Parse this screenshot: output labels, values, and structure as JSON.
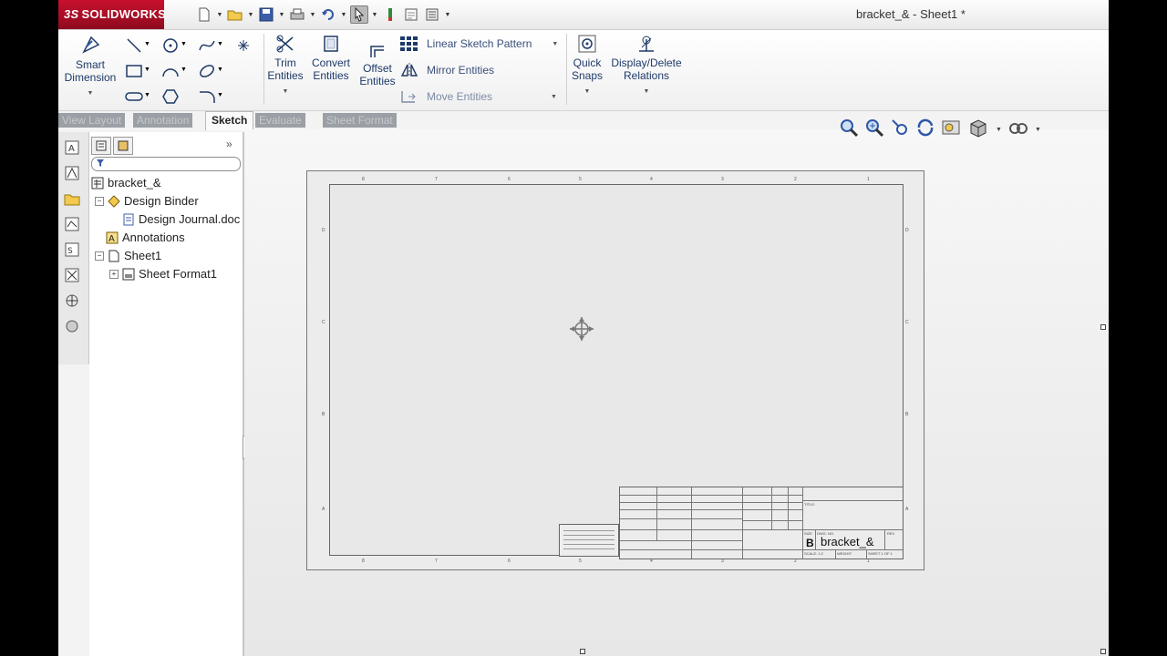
{
  "app": {
    "brand": "SOLIDWORKS",
    "brand_prefix": "3S",
    "document_title": "bracket_& - Sheet1 *",
    "accent_color": "#c8102e"
  },
  "quick_access": {
    "icons": [
      "new-icon",
      "open-icon",
      "save-icon",
      "print-icon",
      "undo-icon",
      "select-icon",
      "rebuild-icon",
      "file-properties-icon",
      "options-icon"
    ]
  },
  "command_manager": {
    "smart_dimension": "Smart\nDimension",
    "smart_dimension_l1": "Smart",
    "smart_dimension_l2": "Dimension",
    "trim_l1": "Trim",
    "trim_l2": "Entities",
    "convert_l1": "Convert",
    "convert_l2": "Entities",
    "offset_l1": "Offset",
    "offset_l2": "Entities",
    "linear_pattern": "Linear Sketch Pattern",
    "mirror": "Mirror Entities",
    "move": "Move Entities",
    "quick_l1": "Quick",
    "quick_l2": "Snaps",
    "relations_l1": "Display/Delete",
    "relations_l2": "Relations"
  },
  "tabs": {
    "view_layout": "View Layout",
    "annotation": "Annotation",
    "sketch": "Sketch",
    "evaluate": "Evaluate",
    "sheet_format": "Sheet Format"
  },
  "feature_tree": {
    "root": "bracket_&",
    "design_binder": "Design Binder",
    "design_journal": "Design Journal.doc",
    "annotations": "Annotations",
    "sheet1": "Sheet1",
    "sheet_format": "Sheet Format1"
  },
  "title_block": {
    "size": "B",
    "dwg_no": "bracket_&",
    "size_label": "SIZE",
    "dwg_label": "DWG. NO.",
    "rev_label": "REV",
    "scale_label": "SCALE: 1:2",
    "weight_label": "WEIGHT:",
    "sheet_label": "SHEET 1 OF 1",
    "title_label": "TITLE:"
  },
  "zones": {
    "top": [
      "8",
      "7",
      "6",
      "5",
      "4",
      "3",
      "2",
      "1"
    ],
    "side": [
      "D",
      "C",
      "B",
      "A"
    ]
  }
}
